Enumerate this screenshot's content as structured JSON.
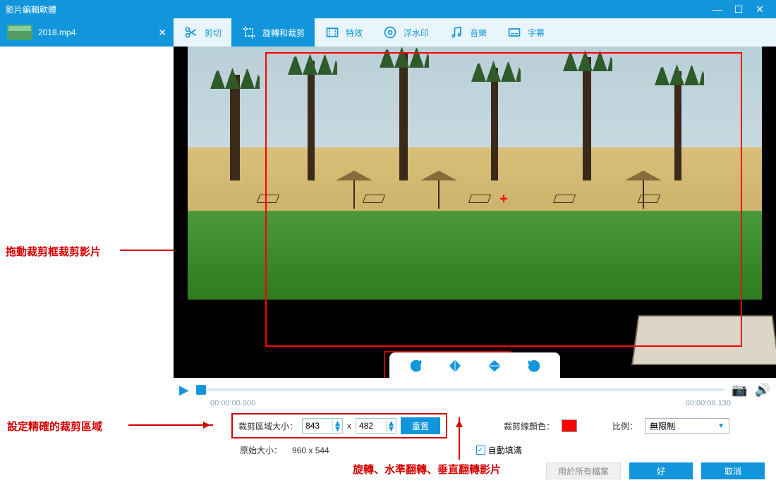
{
  "window": {
    "title": "影片編輯軟體"
  },
  "file": {
    "name": "2018.mp4"
  },
  "tabs": {
    "cut": "剪切",
    "rotate_crop": "旋轉和裁剪",
    "effects": "特效",
    "watermark": "浮水印",
    "music": "音樂",
    "subtitle": "字幕"
  },
  "playback": {
    "current_time": "00:00:00.000",
    "total_time": "00:00:08.130"
  },
  "crop": {
    "size_label": "裁剪區域大小：",
    "width": "843",
    "height": "482",
    "reset": "重置",
    "original_label": "原始大小：",
    "original_value": "960 x 544",
    "line_color_label": "裁剪線顏色：",
    "line_color": "#ff0000",
    "ratio_label": "比例：",
    "ratio_value": "無限制",
    "autofill_label": "自動填滿",
    "autofill_checked": true
  },
  "buttons": {
    "apply_all": "用於所有檔案",
    "ok": "好",
    "cancel": "取消"
  },
  "annotations": {
    "drag_crop": "拖動裁剪框裁剪影片",
    "set_precise": "設定精確的裁剪區域",
    "rotate_flip": "旋轉、水準翻轉、垂直翻轉影片"
  }
}
